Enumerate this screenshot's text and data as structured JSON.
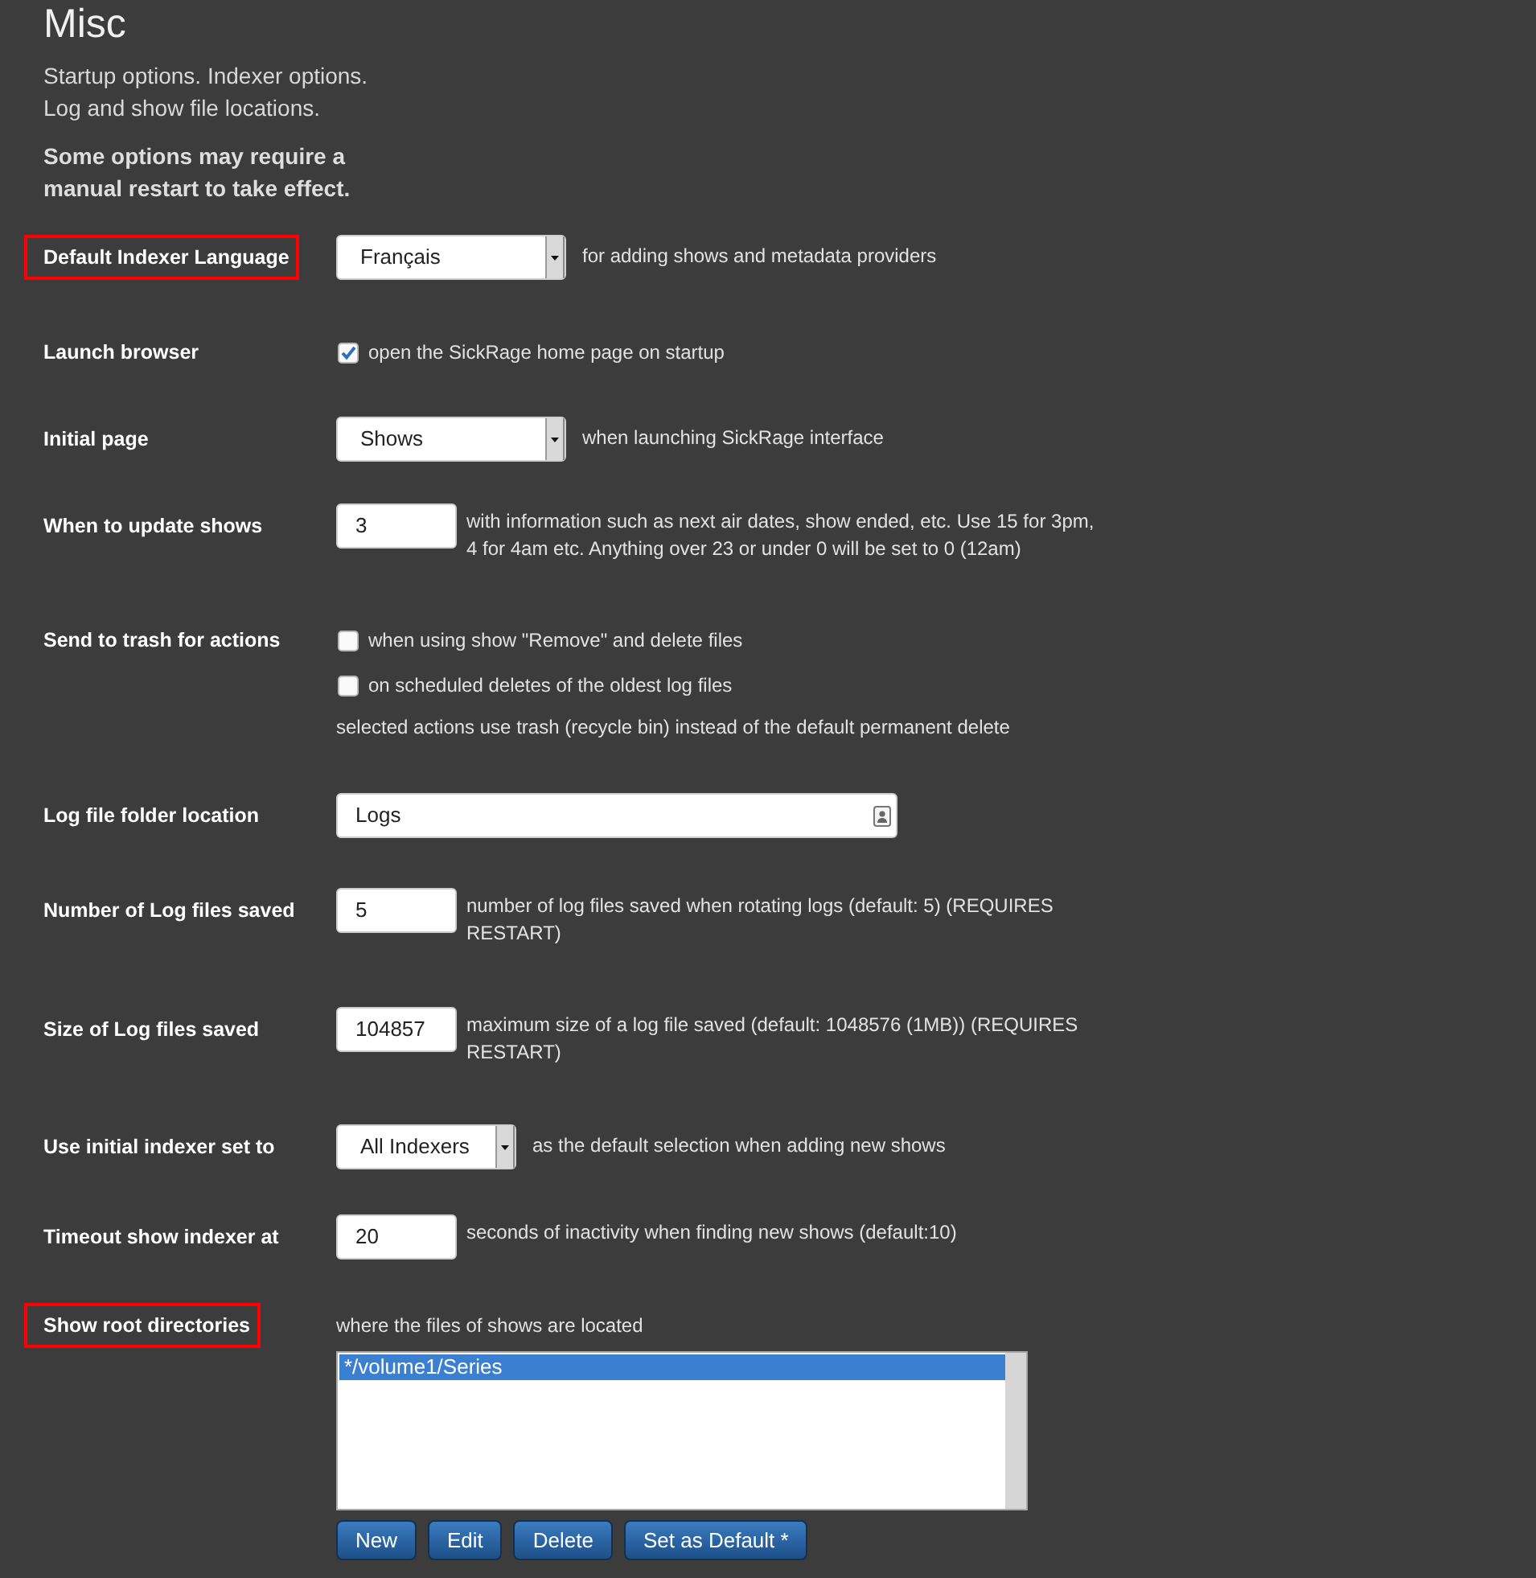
{
  "section": {
    "title": "Misc",
    "description": "Startup options. Indexer options. Log and show file locations.",
    "note": "Some options may require a manual restart to take effect."
  },
  "settings": [
    {
      "kind": "select",
      "label": "Default Indexer Language",
      "highlighted": true,
      "value": "Français",
      "description": "for adding shows and metadata providers"
    },
    {
      "kind": "checkbox",
      "label": "Launch browser",
      "highlighted": false,
      "options": [
        {
          "label": "open the SickRage home page on startup",
          "checked": true
        }
      ]
    },
    {
      "kind": "select",
      "label": "Initial page",
      "highlighted": false,
      "value": "Shows",
      "description": "when launching SickRage interface"
    },
    {
      "kind": "number",
      "label": "When to update shows",
      "highlighted": false,
      "value": "3",
      "description": "with information such as next air dates, show ended, etc. Use 15 for 3pm, 4 for 4am etc. Anything over 23 or under 0 will be set to 0 (12am)"
    },
    {
      "kind": "checkbox",
      "label": "Send to trash for actions",
      "highlighted": false,
      "options": [
        {
          "label": "when using show \"Remove\" and delete files",
          "checked": false
        },
        {
          "label": "on scheduled deletes of the oldest log files",
          "checked": false
        }
      ],
      "description": "selected actions use trash (recycle bin) instead of the default permanent delete"
    },
    {
      "kind": "path",
      "label": "Log file folder location",
      "highlighted": false,
      "value": "Logs"
    },
    {
      "kind": "number",
      "label": "Number of Log files saved",
      "highlighted": false,
      "value": "5",
      "description": "number of log files saved when rotating logs (default: 5) (REQUIRES RESTART)"
    },
    {
      "kind": "number",
      "label": "Size of Log files saved",
      "highlighted": false,
      "value": "104857",
      "description": "maximum size of a log file saved (default: 1048576 (1MB)) (REQUIRES RESTART)"
    },
    {
      "kind": "select",
      "label": "Use initial indexer set to",
      "highlighted": false,
      "value": "All Indexers",
      "description": "as the default selection when adding new shows"
    },
    {
      "kind": "number",
      "label": "Timeout show indexer at",
      "highlighted": false,
      "value": "20",
      "description": "seconds of inactivity when finding new shows (default:10)"
    },
    {
      "kind": "directories",
      "label": "Show root directories",
      "highlighted": true,
      "description": "where the files of shows are located",
      "items": [
        {
          "text": "*/volume1/Series",
          "selected": true
        }
      ],
      "buttons": [
        "New",
        "Edit",
        "Delete",
        "Set as Default *"
      ]
    }
  ]
}
